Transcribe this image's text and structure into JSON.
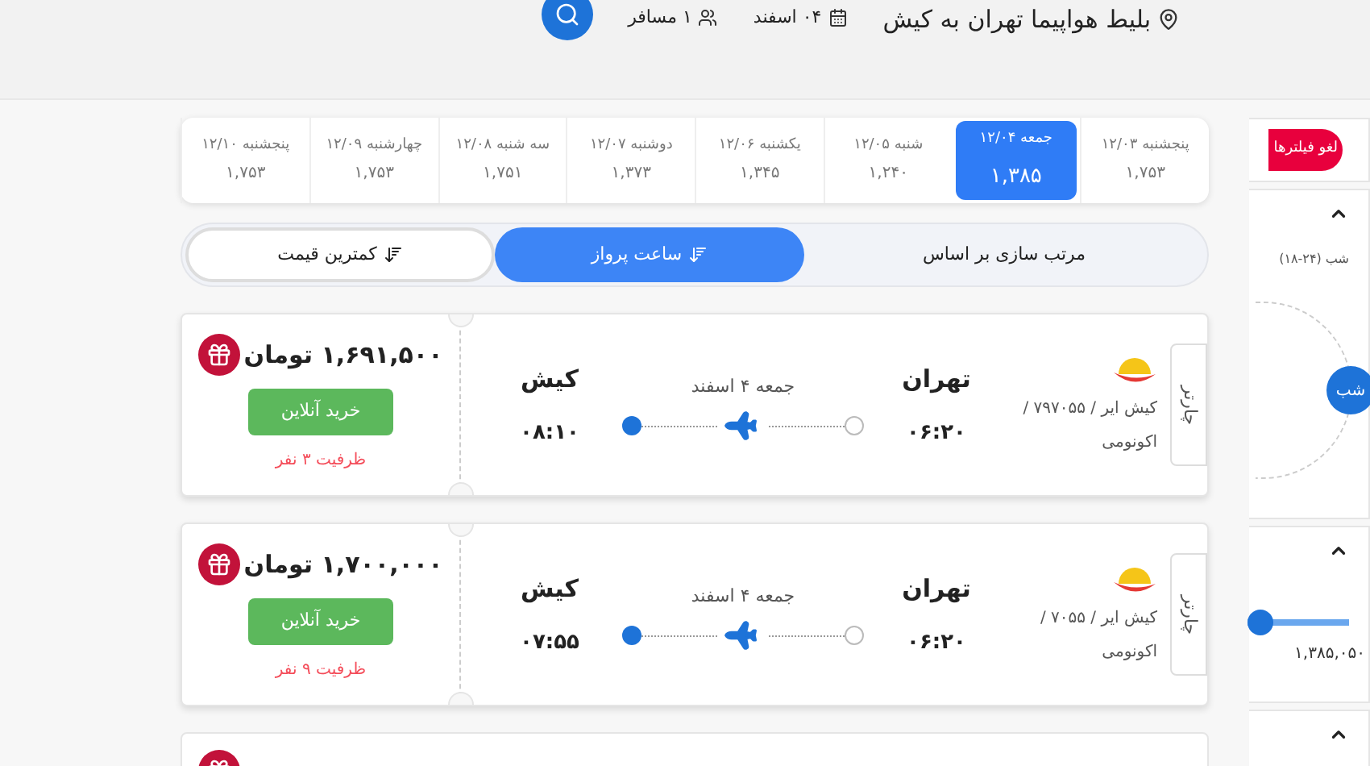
{
  "header": {
    "title": "بلیط هواپیما تهران به کیش",
    "date": "۰۴ اسفند",
    "passengers": "۱ مسافر"
  },
  "date_tabs": [
    {
      "label": "پنجشنبه ۱۲/۰۳",
      "price": "۱,۷۵۳",
      "selected": false
    },
    {
      "label": "جمعه ۱۲/۰۴",
      "price": "۱,۳۸۵",
      "selected": true
    },
    {
      "label": "شنبه ۱۲/۰۵",
      "price": "۱,۲۴۰",
      "selected": false
    },
    {
      "label": "یکشنبه ۱۲/۰۶",
      "price": "۱,۳۴۵",
      "selected": false
    },
    {
      "label": "دوشنبه ۱۲/۰۷",
      "price": "۱,۳۷۳",
      "selected": false
    },
    {
      "label": "سه شنبه ۱۲/۰۸",
      "price": "۱,۷۵۱",
      "selected": false
    },
    {
      "label": "چهارشنبه ۱۲/۰۹",
      "price": "۱,۷۵۳",
      "selected": false
    },
    {
      "label": "پنجشنبه ۱۲/۱۰",
      "price": "۱,۷۵۳",
      "selected": false
    }
  ],
  "sort": {
    "label": "مرتب سازی بر اساس",
    "options": [
      {
        "label": "ساعت پرواز",
        "selected": true
      },
      {
        "label": "کمترین قیمت",
        "selected": false
      }
    ]
  },
  "flights": [
    {
      "charter": "چارتر",
      "airline": "کیش ایر / ۷۹۷۰۵۵ /",
      "cabin": "اکونومی",
      "origin": "تهران",
      "depart_time": "۰۶:۲۰",
      "date": "جمعه ۴ اسفند",
      "destination": "کیش",
      "arrive_time": "۰۸:۱۰",
      "price": "۱,۶۹۱,۵۰۰ تومان",
      "buy": "خرید آنلاین",
      "capacity": "ظرفیت ۳ نفر"
    },
    {
      "charter": "چارتر",
      "airline": "کیش ایر / ۷۰۵۵ /",
      "cabin": "اکونومی",
      "origin": "تهران",
      "depart_time": "۰۶:۲۰",
      "date": "جمعه ۴ اسفند",
      "destination": "کیش",
      "arrive_time": "۰۷:۵۵",
      "price": "۱,۷۰۰,۰۰۰ تومان",
      "buy": "خرید آنلاین",
      "capacity": "ظرفیت ۹ نفر"
    }
  ],
  "sidebar": {
    "clear_filters": "لغو فیلترها",
    "time_label": "شب (۲۴-۱۸)",
    "time_badge": "شب",
    "price_min": "۱,۳۸۵,۰۵۰",
    "price_slider": {
      "level": 1
    }
  }
}
